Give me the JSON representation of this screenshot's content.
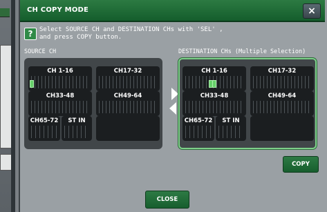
{
  "window": {
    "title": "CH COPY MODE",
    "close_icon": "×"
  },
  "instructions": {
    "help_icon": "?",
    "line1": "Select SOURCE CH and DESTINATION CHs with 'SEL' ,",
    "line2": "and press COPY button."
  },
  "source": {
    "label": "SOURCE CH",
    "blocks": [
      "CH 1-16",
      "CH17-32",
      "CH33-48",
      "CH49-64",
      "CH65-72",
      "ST IN"
    ]
  },
  "destination": {
    "label": "DESTINATION CHs (Multiple Selection)",
    "blocks": [
      "CH 1-16",
      "CH17-32",
      "CH33-48",
      "CH49-64",
      "CH65-72",
      "ST IN"
    ]
  },
  "buttons": {
    "copy": "COPY",
    "close": "CLOSE"
  },
  "colors": {
    "title_bar": "#1f6b37",
    "accent": "#2d7a44",
    "selected": "#66d06a"
  }
}
